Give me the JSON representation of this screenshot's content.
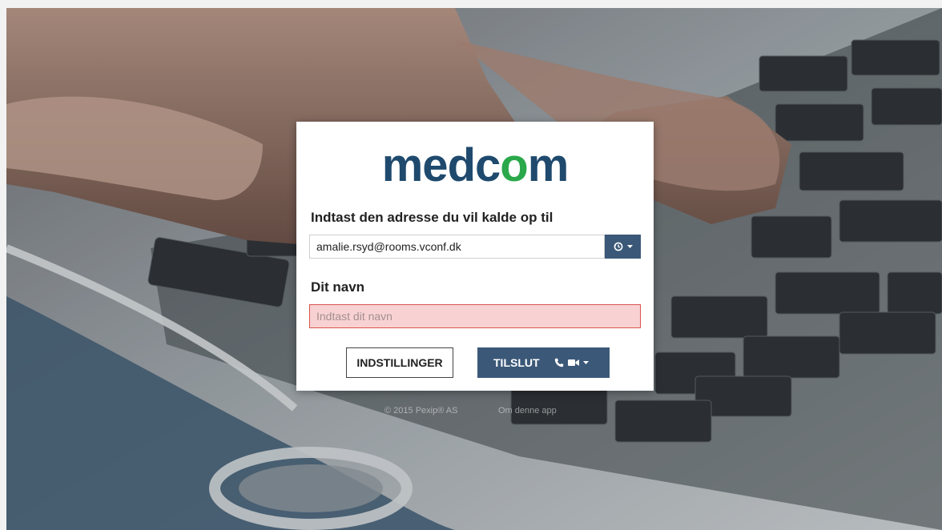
{
  "logo": {
    "text_main": "medc",
    "text_o": "o",
    "text_end": "m",
    "brand_color": "#1f4a6e",
    "accent_color": "#2aa84a"
  },
  "address": {
    "label": "Indtast den adresse du vil kalde op til",
    "value": "amalie.rsyd@rooms.vconf.dk",
    "history_icon": "history-icon"
  },
  "name": {
    "label": "Dit navn",
    "placeholder": "Indtast dit navn",
    "value": ""
  },
  "buttons": {
    "settings_label": "INDSTILLINGER",
    "connect_label": "TILSLUT",
    "connect_icons": [
      "phone-icon",
      "video-camera-icon",
      "caret-down-icon"
    ]
  },
  "footer": {
    "copyright": "© 2015 Pexip® AS",
    "about_link": "Om denne app"
  },
  "colors": {
    "primary": "#3b5878",
    "error_bg": "#f8d2d3",
    "error_border": "#d9534f"
  }
}
